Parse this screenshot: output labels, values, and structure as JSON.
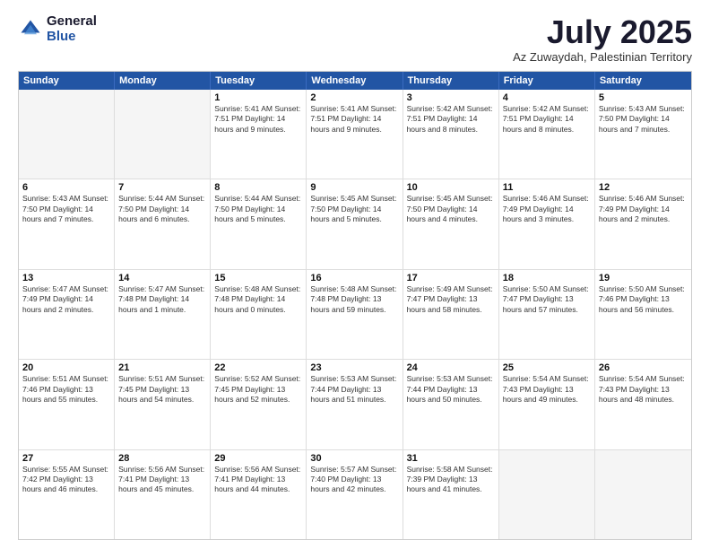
{
  "logo": {
    "general": "General",
    "blue": "Blue"
  },
  "header": {
    "month": "July 2025",
    "location": "Az Zuwaydah, Palestinian Territory"
  },
  "days": [
    "Sunday",
    "Monday",
    "Tuesday",
    "Wednesday",
    "Thursday",
    "Friday",
    "Saturday"
  ],
  "weeks": [
    [
      {
        "day": "",
        "empty": true
      },
      {
        "day": "",
        "empty": true
      },
      {
        "day": "1",
        "info": "Sunrise: 5:41 AM\nSunset: 7:51 PM\nDaylight: 14 hours\nand 9 minutes."
      },
      {
        "day": "2",
        "info": "Sunrise: 5:41 AM\nSunset: 7:51 PM\nDaylight: 14 hours\nand 9 minutes."
      },
      {
        "day": "3",
        "info": "Sunrise: 5:42 AM\nSunset: 7:51 PM\nDaylight: 14 hours\nand 8 minutes."
      },
      {
        "day": "4",
        "info": "Sunrise: 5:42 AM\nSunset: 7:51 PM\nDaylight: 14 hours\nand 8 minutes."
      },
      {
        "day": "5",
        "info": "Sunrise: 5:43 AM\nSunset: 7:50 PM\nDaylight: 14 hours\nand 7 minutes."
      }
    ],
    [
      {
        "day": "6",
        "info": "Sunrise: 5:43 AM\nSunset: 7:50 PM\nDaylight: 14 hours\nand 7 minutes."
      },
      {
        "day": "7",
        "info": "Sunrise: 5:44 AM\nSunset: 7:50 PM\nDaylight: 14 hours\nand 6 minutes."
      },
      {
        "day": "8",
        "info": "Sunrise: 5:44 AM\nSunset: 7:50 PM\nDaylight: 14 hours\nand 5 minutes."
      },
      {
        "day": "9",
        "info": "Sunrise: 5:45 AM\nSunset: 7:50 PM\nDaylight: 14 hours\nand 5 minutes."
      },
      {
        "day": "10",
        "info": "Sunrise: 5:45 AM\nSunset: 7:50 PM\nDaylight: 14 hours\nand 4 minutes."
      },
      {
        "day": "11",
        "info": "Sunrise: 5:46 AM\nSunset: 7:49 PM\nDaylight: 14 hours\nand 3 minutes."
      },
      {
        "day": "12",
        "info": "Sunrise: 5:46 AM\nSunset: 7:49 PM\nDaylight: 14 hours\nand 2 minutes."
      }
    ],
    [
      {
        "day": "13",
        "info": "Sunrise: 5:47 AM\nSunset: 7:49 PM\nDaylight: 14 hours\nand 2 minutes."
      },
      {
        "day": "14",
        "info": "Sunrise: 5:47 AM\nSunset: 7:48 PM\nDaylight: 14 hours\nand 1 minute."
      },
      {
        "day": "15",
        "info": "Sunrise: 5:48 AM\nSunset: 7:48 PM\nDaylight: 14 hours\nand 0 minutes."
      },
      {
        "day": "16",
        "info": "Sunrise: 5:48 AM\nSunset: 7:48 PM\nDaylight: 13 hours\nand 59 minutes."
      },
      {
        "day": "17",
        "info": "Sunrise: 5:49 AM\nSunset: 7:47 PM\nDaylight: 13 hours\nand 58 minutes."
      },
      {
        "day": "18",
        "info": "Sunrise: 5:50 AM\nSunset: 7:47 PM\nDaylight: 13 hours\nand 57 minutes."
      },
      {
        "day": "19",
        "info": "Sunrise: 5:50 AM\nSunset: 7:46 PM\nDaylight: 13 hours\nand 56 minutes."
      }
    ],
    [
      {
        "day": "20",
        "info": "Sunrise: 5:51 AM\nSunset: 7:46 PM\nDaylight: 13 hours\nand 55 minutes."
      },
      {
        "day": "21",
        "info": "Sunrise: 5:51 AM\nSunset: 7:45 PM\nDaylight: 13 hours\nand 54 minutes."
      },
      {
        "day": "22",
        "info": "Sunrise: 5:52 AM\nSunset: 7:45 PM\nDaylight: 13 hours\nand 52 minutes."
      },
      {
        "day": "23",
        "info": "Sunrise: 5:53 AM\nSunset: 7:44 PM\nDaylight: 13 hours\nand 51 minutes."
      },
      {
        "day": "24",
        "info": "Sunrise: 5:53 AM\nSunset: 7:44 PM\nDaylight: 13 hours\nand 50 minutes."
      },
      {
        "day": "25",
        "info": "Sunrise: 5:54 AM\nSunset: 7:43 PM\nDaylight: 13 hours\nand 49 minutes."
      },
      {
        "day": "26",
        "info": "Sunrise: 5:54 AM\nSunset: 7:43 PM\nDaylight: 13 hours\nand 48 minutes."
      }
    ],
    [
      {
        "day": "27",
        "info": "Sunrise: 5:55 AM\nSunset: 7:42 PM\nDaylight: 13 hours\nand 46 minutes."
      },
      {
        "day": "28",
        "info": "Sunrise: 5:56 AM\nSunset: 7:41 PM\nDaylight: 13 hours\nand 45 minutes."
      },
      {
        "day": "29",
        "info": "Sunrise: 5:56 AM\nSunset: 7:41 PM\nDaylight: 13 hours\nand 44 minutes."
      },
      {
        "day": "30",
        "info": "Sunrise: 5:57 AM\nSunset: 7:40 PM\nDaylight: 13 hours\nand 42 minutes."
      },
      {
        "day": "31",
        "info": "Sunrise: 5:58 AM\nSunset: 7:39 PM\nDaylight: 13 hours\nand 41 minutes."
      },
      {
        "day": "",
        "empty": true
      },
      {
        "day": "",
        "empty": true
      }
    ]
  ]
}
